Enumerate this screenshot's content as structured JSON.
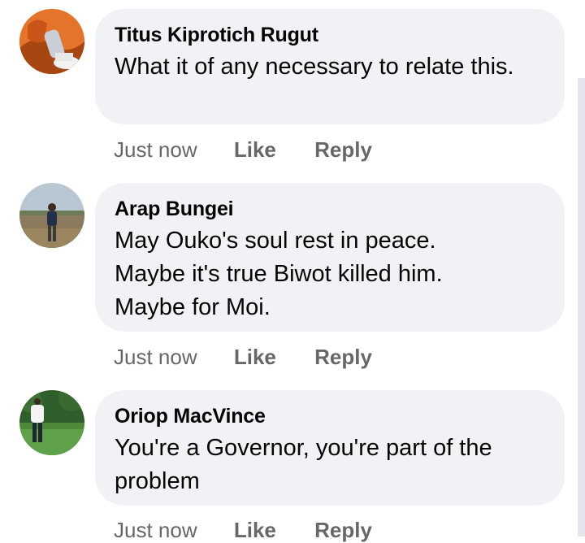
{
  "comments": [
    {
      "author": "Titus Kiprotich Rugut",
      "text": "What it of any necessary to relate this.",
      "time": "Just now",
      "like": "Like",
      "reply": "Reply"
    },
    {
      "author": "Arap Bungei",
      "text": "May Ouko's soul rest in peace. Maybe it's true Biwot killed him. Maybe for Moi.",
      "time": "Just now",
      "like": "Like",
      "reply": "Reply"
    },
    {
      "author": "Oriop MacVince",
      "text": "You're a Governor, you're part of the problem",
      "time": "Just now",
      "like": "Like",
      "reply": "Reply"
    }
  ],
  "colors": {
    "bubble": "#f0f2f5",
    "meta": "#65676b",
    "text": "#050505"
  }
}
